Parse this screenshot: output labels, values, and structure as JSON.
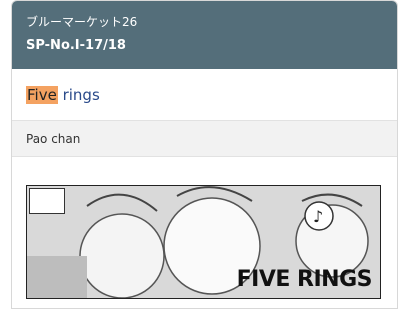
{
  "header": {
    "event_name": "ブルーマーケット26",
    "circle_code": "SP-No.I-17/18"
  },
  "title": {
    "highlight": "Five",
    "rest": " rings"
  },
  "author": "Pao chan",
  "cover": {
    "logo_text": "FIVE RINGS"
  },
  "colors": {
    "header_bg": "#546e7a",
    "highlight": "#f4a261",
    "link": "#2a4a8a"
  }
}
